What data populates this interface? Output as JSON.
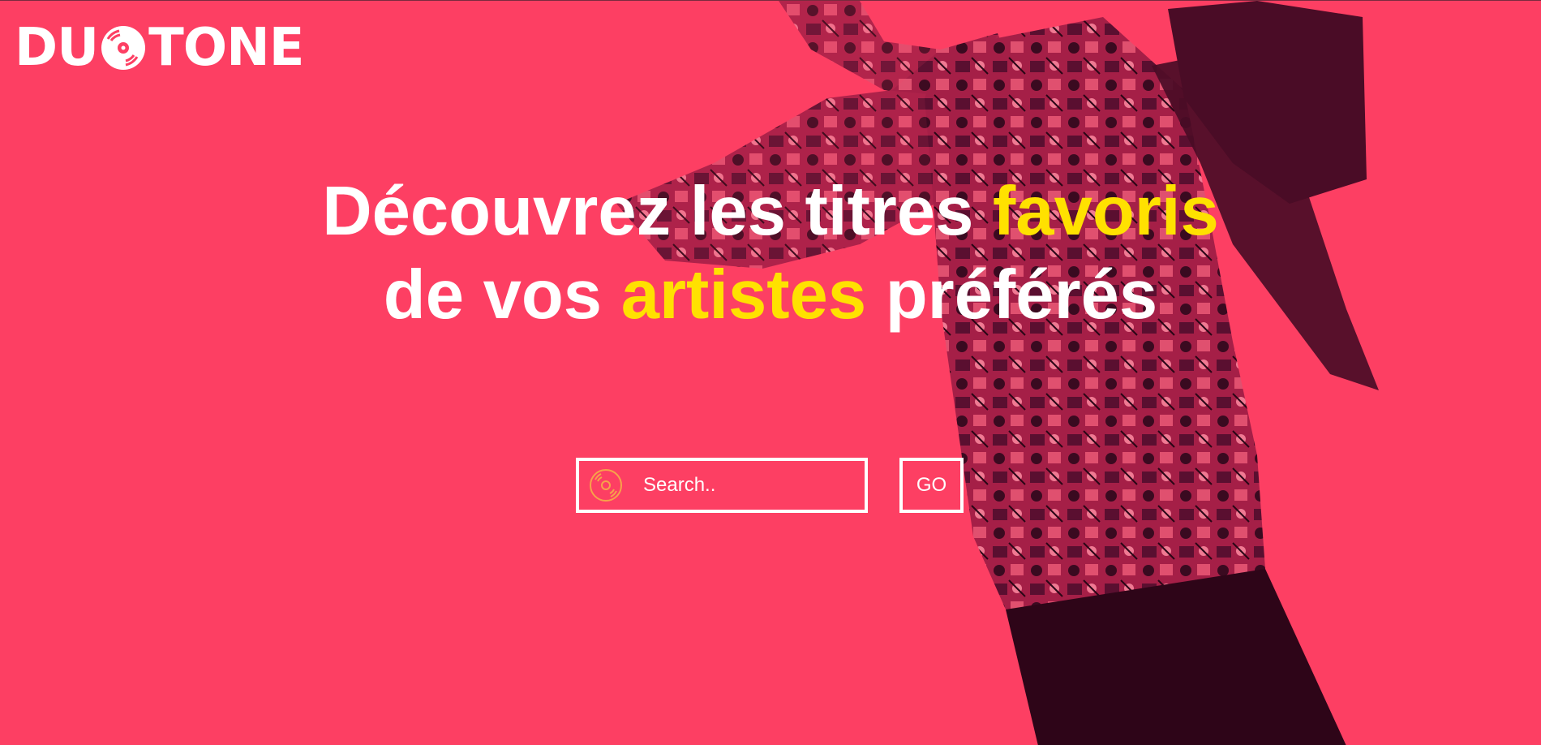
{
  "brand": {
    "name_part1": "DU",
    "name_part2": "TONE",
    "logo_icon": "vinyl-disc-icon"
  },
  "hero": {
    "line1_a": "Découvrez les titres ",
    "line1_highlight": "favoris",
    "line2_a": "de vos ",
    "line2_highlight": "artistes",
    "line2_b": " préférés"
  },
  "search": {
    "placeholder": "Search..",
    "value": "",
    "icon": "vinyl-disc-icon",
    "button_label": "GO"
  },
  "colors": {
    "background": "#fd3f63",
    "highlight": "#ffe100",
    "text": "#ffffff",
    "duotone_dark": "#5a0f30",
    "search_icon": "#f7a24a"
  }
}
